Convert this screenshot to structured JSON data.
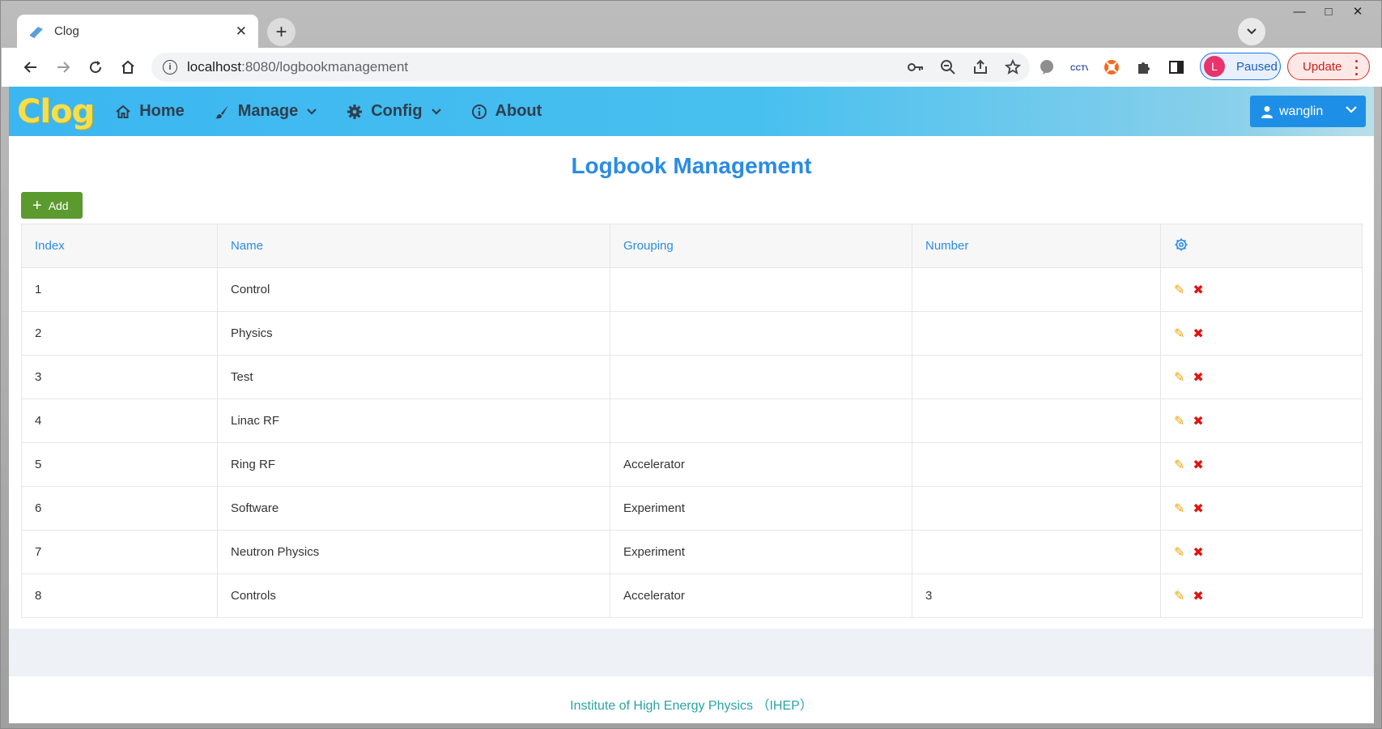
{
  "browser": {
    "tab_title": "Clog",
    "url_host": "localhost",
    "url_path": ":8080/logbookmanagement",
    "profile_initial": "L",
    "profile_status": "Paused",
    "update_label": "Update",
    "accent": "#1a73e8"
  },
  "app": {
    "logo": "Clog",
    "nav": {
      "home": "Home",
      "manage": "Manage",
      "config": "Config",
      "about": "About"
    },
    "user": "wanglin"
  },
  "main": {
    "title": "Logbook Management",
    "add_label": "Add",
    "columns": [
      "Index",
      "Name",
      "Grouping",
      "Number"
    ],
    "rows": [
      {
        "index": "1",
        "name": "Control",
        "grouping": "",
        "number": ""
      },
      {
        "index": "2",
        "name": "Physics",
        "grouping": "",
        "number": ""
      },
      {
        "index": "3",
        "name": "Test",
        "grouping": "",
        "number": ""
      },
      {
        "index": "4",
        "name": "Linac RF",
        "grouping": "",
        "number": ""
      },
      {
        "index": "5",
        "name": "Ring RF",
        "grouping": "Accelerator",
        "number": ""
      },
      {
        "index": "6",
        "name": "Software",
        "grouping": "Experiment",
        "number": ""
      },
      {
        "index": "7",
        "name": "Neutron Physics",
        "grouping": "Experiment",
        "number": ""
      },
      {
        "index": "8",
        "name": "Controls",
        "grouping": "Accelerator",
        "number": "3"
      }
    ]
  },
  "footer": {
    "text": "Institute of High Energy Physics （IHEP）"
  },
  "colors": {
    "header_blue": "#3bb6f0",
    "title_blue": "#2a8be3",
    "add_green": "#5b9a2e",
    "edit_orange": "#f2a200",
    "delete_red": "#e0140f"
  }
}
